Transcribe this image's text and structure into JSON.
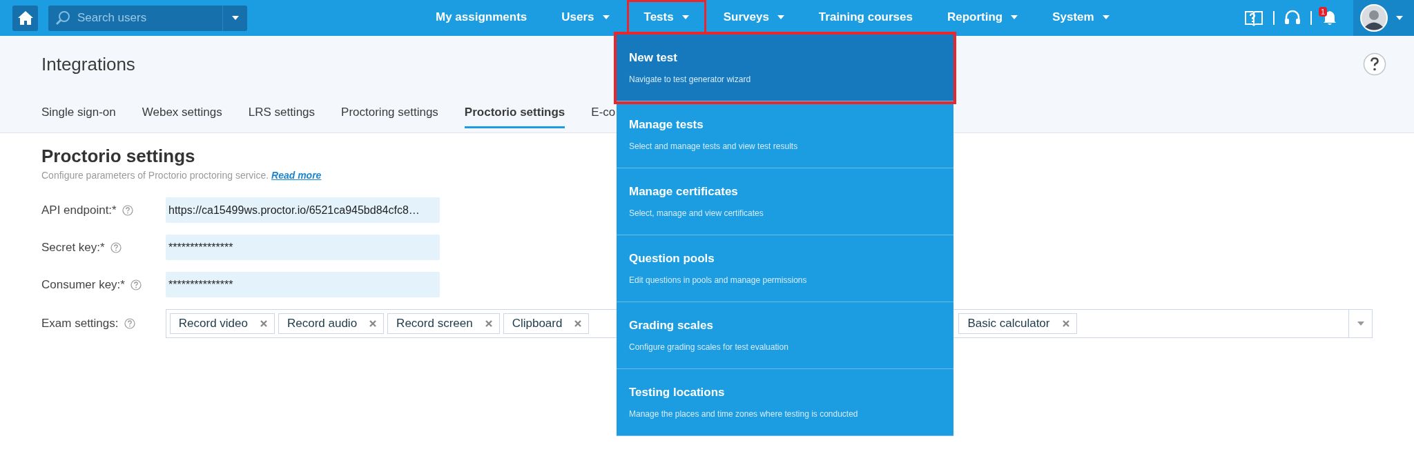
{
  "top_bar": {
    "search": {
      "placeholder": "Search users"
    },
    "nav": [
      {
        "label": "My assignments",
        "has_menu": false,
        "highlighted": false
      },
      {
        "label": "Users",
        "has_menu": true,
        "highlighted": false
      },
      {
        "label": "Tests",
        "has_menu": true,
        "highlighted": true
      },
      {
        "label": "Surveys",
        "has_menu": true,
        "highlighted": false
      },
      {
        "label": "Training courses",
        "has_menu": false,
        "highlighted": false
      },
      {
        "label": "Reporting",
        "has_menu": true,
        "highlighted": false
      },
      {
        "label": "System",
        "has_menu": true,
        "highlighted": false
      }
    ],
    "notifications": {
      "badge": "1"
    }
  },
  "page": {
    "title": "Integrations",
    "tabs": [
      {
        "label": "Single sign-on",
        "selected": false
      },
      {
        "label": "Webex settings",
        "selected": false
      },
      {
        "label": "LRS settings",
        "selected": false
      },
      {
        "label": "Proctoring settings",
        "selected": false
      },
      {
        "label": "Proctorio settings",
        "selected": true
      },
      {
        "label": "E-co",
        "selected": false
      }
    ]
  },
  "section": {
    "title": "Proctorio settings",
    "description": "Configure parameters of Proctorio proctoring service.",
    "link": "Read more",
    "fields": [
      {
        "label": "API endpoint:*",
        "value": "https://ca15499ws.proctor.io/6521ca945bd84cfc8…"
      },
      {
        "label": "Secret key:*",
        "value": "***************"
      },
      {
        "label": "Consumer key:*",
        "value": "***************"
      }
    ],
    "exam_settings": {
      "label": "Exam settings:",
      "tags": [
        {
          "label": "Record video"
        },
        {
          "label": "Record audio"
        },
        {
          "label": "Record screen"
        },
        {
          "label": "Clipboard"
        },
        {
          "label": "Basic calculator"
        }
      ]
    }
  },
  "tests_menu": [
    {
      "title": "New test",
      "description": "Navigate to test generator wizard",
      "selected": true,
      "highlighted": true
    },
    {
      "title": "Manage tests",
      "description": "Select and manage tests and view test results",
      "selected": false,
      "highlighted": false
    },
    {
      "title": "Manage certificates",
      "description": "Select, manage and view certificates",
      "selected": false,
      "highlighted": false
    },
    {
      "title": "Question pools",
      "description": "Edit questions in pools and manage permissions",
      "selected": false,
      "highlighted": false
    },
    {
      "title": "Grading scales",
      "description": "Configure grading scales for test evaluation",
      "selected": false,
      "highlighted": false
    },
    {
      "title": "Testing locations",
      "description": "Manage the places and time zones where testing is conducted",
      "selected": false,
      "highlighted": false
    }
  ]
}
